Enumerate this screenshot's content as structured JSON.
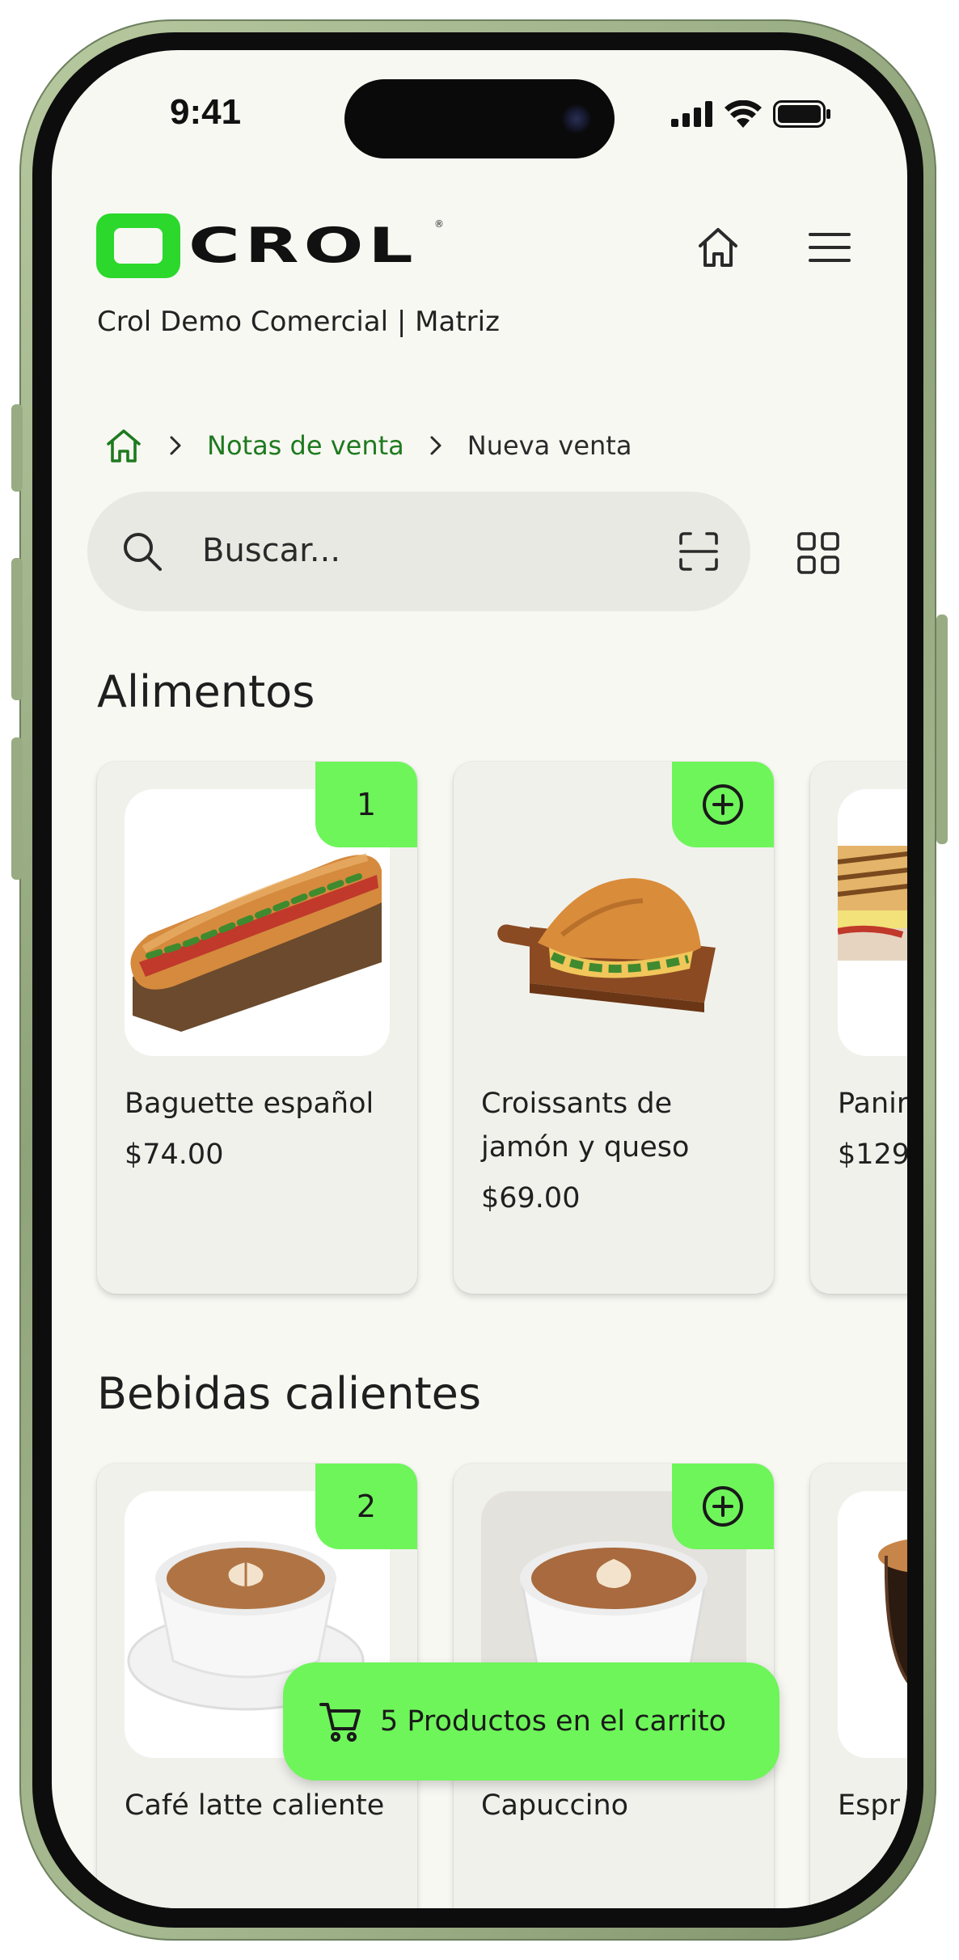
{
  "status": {
    "time": "9:41"
  },
  "brand": {
    "name": "CROL",
    "mark": "®"
  },
  "company": "Crol Demo Comercial | Matriz",
  "breadcrumb": {
    "parent": "Notas de venta",
    "current": "Nueva venta"
  },
  "search": {
    "placeholder": "Buscar..."
  },
  "sections": [
    {
      "title": "Alimentos",
      "products": [
        {
          "name": "Baguette español",
          "price": "$74.00",
          "quantity": "1"
        },
        {
          "name": "Croissants de jamón y queso",
          "price": "$69.00",
          "quantity": ""
        },
        {
          "name": "Panir",
          "price": "$129"
        }
      ]
    },
    {
      "title": "Bebidas calientes",
      "products": [
        {
          "name": "Café latte caliente",
          "quantity": "2"
        },
        {
          "name": "Capuccino",
          "quantity": ""
        },
        {
          "name": "Espr"
        }
      ]
    }
  ],
  "cart": {
    "label": "5 Productos en el carrito"
  },
  "colors": {
    "accent": "#6ef55a",
    "brand": "#2bd82b",
    "link": "#1e7a1e",
    "background": "#f8f8f3"
  }
}
